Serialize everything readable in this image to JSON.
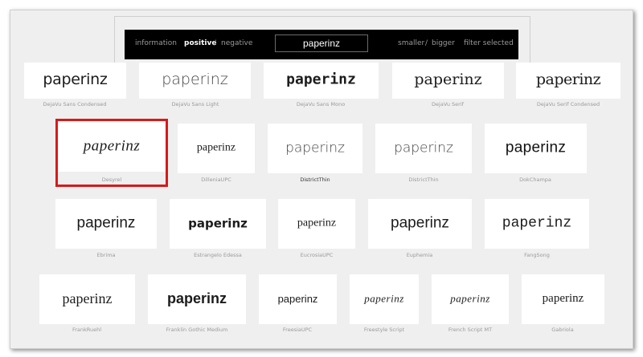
{
  "toolbar": {
    "information_label": "information",
    "positive_label": "positive",
    "separator1": "/",
    "negative_label": "negative",
    "search_value": "paperinz",
    "smaller_label": "smaller",
    "separator2": "/",
    "bigger_label": "bigger",
    "filter_label": "filter selected"
  },
  "sample_text": "paperinz",
  "fonts": [
    {
      "name": "DejaVu Sans Condensed",
      "sample": "paperinz"
    },
    {
      "name": "DejaVu Sans Light",
      "sample": "paperinz"
    },
    {
      "name": "DejaVu Sans Mono",
      "sample": "paperinz"
    },
    {
      "name": "DejaVu Serif",
      "sample": "paperinz"
    },
    {
      "name": "DejaVu Serif Condensed",
      "sample": "paperinz"
    },
    {
      "name": "Desyrel",
      "sample": "paperinz"
    },
    {
      "name": "DilleniaUPC",
      "sample": "paperinz"
    },
    {
      "name": "DistrictThin",
      "sample": "paperinz"
    },
    {
      "name": "DistrictThin",
      "sample": "paperinz"
    },
    {
      "name": "DokChampa",
      "sample": "paperinz"
    },
    {
      "name": "Ebrima",
      "sample": "paperinz"
    },
    {
      "name": "Estrangelo Edessa",
      "sample": "paperinz"
    },
    {
      "name": "EucrosiaUPC",
      "sample": "paperinz"
    },
    {
      "name": "Euphemia",
      "sample": "paperinz"
    },
    {
      "name": "FangSong",
      "sample": "paperinz"
    },
    {
      "name": "FrankRuehl",
      "sample": "paperinz"
    },
    {
      "name": "Franklin Gothic Medium",
      "sample": "paperinz"
    },
    {
      "name": "FreesiaUPC",
      "sample": "paperinz"
    },
    {
      "name": "Freestyle Script",
      "sample": "paperinz"
    },
    {
      "name": "French Script MT",
      "sample": "paperinz"
    },
    {
      "name": "Gabriola",
      "sample": "paperinz"
    }
  ],
  "selected_font": "Desyrel",
  "colors": {
    "selection": "#d71a1a",
    "toolbar_bg": "#000000",
    "page_bg": "#efefef"
  }
}
